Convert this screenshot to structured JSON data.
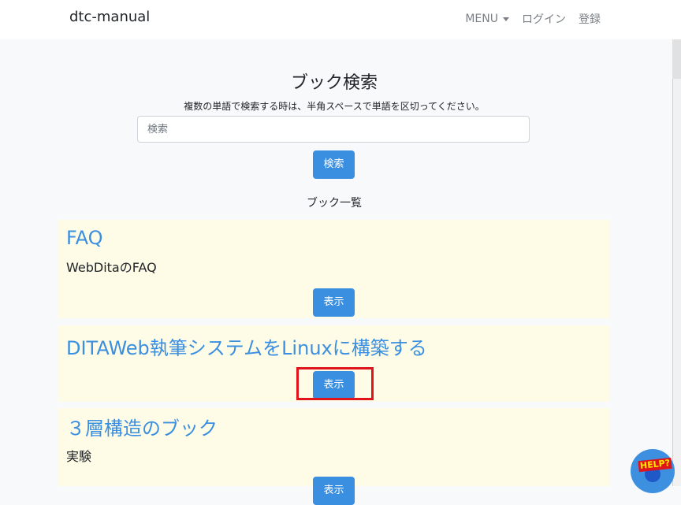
{
  "navbar": {
    "brand": "dtc-manual",
    "menu": "MENU",
    "login": "ログイン",
    "register": "登録"
  },
  "search": {
    "title": "ブック検索",
    "hint": "複数の単語で検索する時は、半角スペースで単語を区切ってください。",
    "placeholder": "検索",
    "button": "検索"
  },
  "book_list": {
    "title": "ブック一覧",
    "books": [
      {
        "title": "FAQ",
        "description": "WebDitaのFAQ",
        "button": "表示"
      },
      {
        "title": "DITAWeb執筆システムをLinuxに構築する",
        "description": "",
        "button": "表示"
      },
      {
        "title": "３層構造のブック",
        "description": "実験",
        "button": "表示"
      }
    ]
  },
  "help": {
    "label": "HELP?"
  },
  "colors": {
    "accent": "#3b8fe0",
    "card_bg": "#fefbe6",
    "highlight": "#e0141b"
  }
}
